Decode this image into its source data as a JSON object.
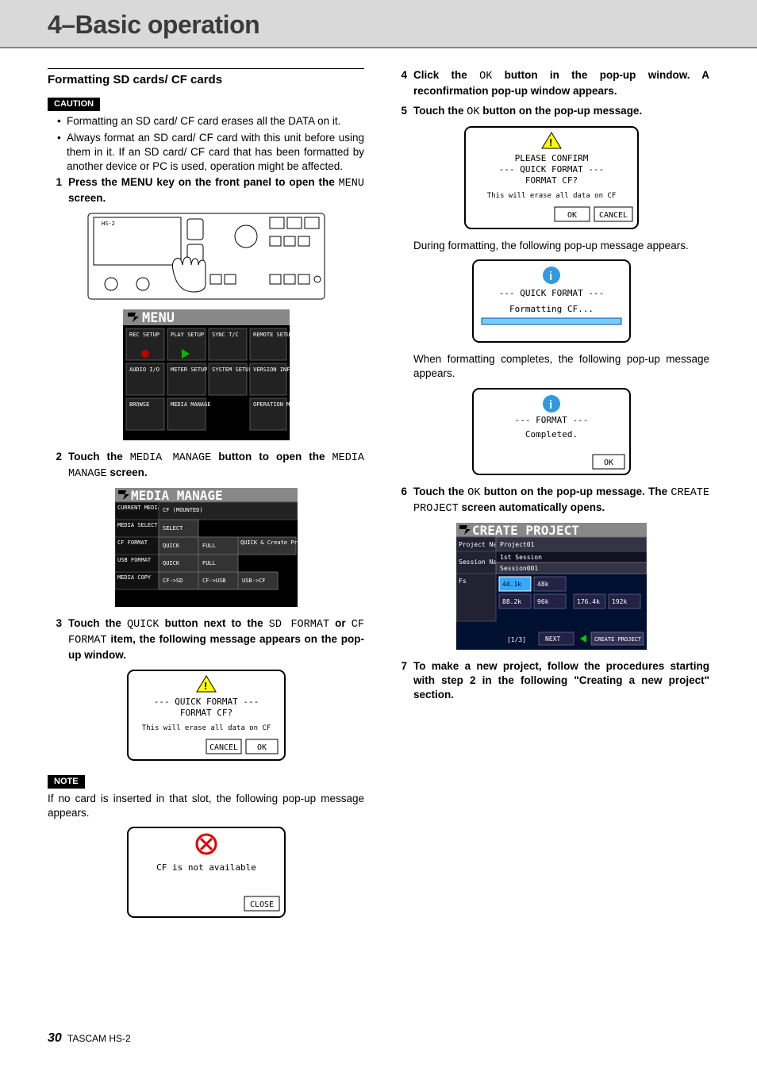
{
  "header": {
    "title": "4–Basic operation"
  },
  "left": {
    "subhead": "Formatting SD cards/ CF cards",
    "caution_tag": "CAUTION",
    "bullets": [
      "Formatting an SD card/ CF card erases all the DATA on it.",
      "Always format an SD card/ CF card with this unit before using them in it. If an SD card/ CF card that has been formatted by another device or PC is used, operation might be affected."
    ],
    "step1_a": "Press the MENU key on the front panel to open the ",
    "step1_mono": "MENU",
    "step1_b": " screen.",
    "step2_a": "Touch the ",
    "step2_mono1": "MEDIA MANAGE",
    "step2_b": " button to open the ",
    "step2_mono2": "MEDIA MANAGE",
    "step2_c": " screen.",
    "step3_a": "Touch the ",
    "step3_mono1": "QUICK",
    "step3_b": " button next to the ",
    "step3_mono2": "SD FORMAT",
    "step3_c": " or ",
    "step3_mono3": "CF FORMAT",
    "step3_d": " item, the following message appears on the pop-up window.",
    "note_tag": "NOTE",
    "note_text": "If no card is inserted in that slot, the following pop-up message appears.",
    "device_label": "HS-2",
    "menu_title": "MENU",
    "menu_items": [
      "REC SETUP",
      "PLAY SETUP",
      "SYNC T/C",
      "REMOTE SETUP",
      "AUDIO I/O",
      "METER SETUP",
      "SYSTEM SETUP",
      "VERSION INFO",
      "BROWSE",
      "MEDIA MANAGE",
      "",
      "OPERATION MODE"
    ],
    "media_manage": {
      "title": "MEDIA MANAGE",
      "rows": [
        {
          "label": "CURRENT MEDIA",
          "cells": [
            "CF (MOUNTED)"
          ]
        },
        {
          "label": "MEDIA SELECT",
          "cells": [
            "SELECT"
          ]
        },
        {
          "label": "CF FORMAT",
          "cells": [
            "QUICK",
            "FULL",
            "QUICK & Create Project"
          ]
        },
        {
          "label": "USB FORMAT",
          "cells": [
            "QUICK",
            "FULL"
          ]
        },
        {
          "label": "MEDIA COPY",
          "cells": [
            "CF->SD",
            "CF->USB",
            "USB->CF"
          ]
        }
      ]
    },
    "popup_quickformat": {
      "line1": "--- QUICK FORMAT ---",
      "line2": "FORMAT CF?",
      "line3": "This will erase all data on CF",
      "btn_cancel": "CANCEL",
      "btn_ok": "OK"
    },
    "popup_notavail": {
      "msg": "CF is not available",
      "btn": "CLOSE"
    }
  },
  "right": {
    "step4_a": "Click the ",
    "step4_mono": "OK",
    "step4_b": " button in the pop-up window. A reconfirmation pop-up window appears.",
    "step5_a": "Touch the ",
    "step5_mono": "OK",
    "step5_b": " button on the pop-up message.",
    "popup_confirm": {
      "line1": "PLEASE CONFIRM",
      "line2": "--- QUICK FORMAT ---",
      "line3": "FORMAT CF?",
      "line4": "This will erase all data on CF",
      "btn_ok": "OK",
      "btn_cancel": "CANCEL"
    },
    "during_text": "During formatting, the following pop-up message appears.",
    "popup_formatting": {
      "line1": "--- QUICK FORMAT ---",
      "line2": "Formatting CF..."
    },
    "complete_text": "When formatting completes, the following pop-up message appears.",
    "popup_complete": {
      "line1": "--- FORMAT ---",
      "line2": "Completed.",
      "btn": "OK"
    },
    "step6_a": "Touch the ",
    "step6_mono": "OK",
    "step6_b": " button on the pop-up message. The ",
    "step6_mono2": "CREATE PROJECT",
    "step6_c": " screen automatically opens.",
    "create_project": {
      "title": "CREATE PROJECT",
      "proj_label": "Project Name",
      "proj_val": "Project01",
      "sess_label": "Session Name",
      "sess_subtitle": "1st Session",
      "sess_val": "Session001",
      "fs_label": "Fs",
      "fs_vals": [
        "44.1k",
        "48k",
        "88.2k",
        "96k",
        "176.4k",
        "192k"
      ],
      "page": "[1/3]",
      "next": "NEXT",
      "create": "CREATE PROJECT"
    },
    "step7": "To make a new project, follow the procedures starting with step 2 in the following \"Creating a new project\" section."
  },
  "footer": {
    "page": "30",
    "model": "TASCAM HS-2"
  }
}
